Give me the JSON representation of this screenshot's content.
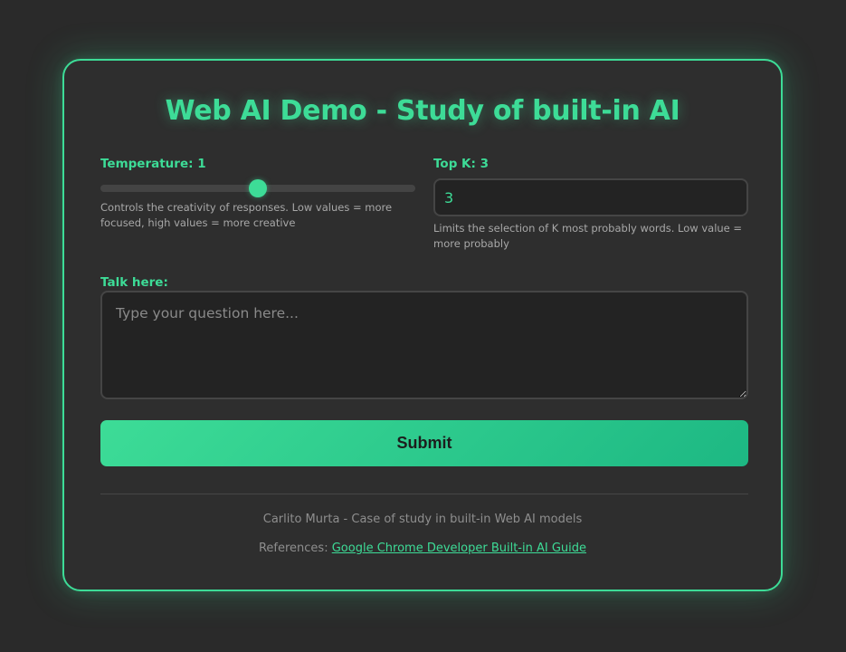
{
  "header": {
    "title": "Web AI Demo - Study of built-in AI"
  },
  "temperature": {
    "label": "Temperature: 1",
    "value": 1,
    "min": 0,
    "max": 2,
    "help": "Controls the creativity of responses. Low values = more focused, high values = more creative"
  },
  "top_k": {
    "label": "Top K: 3",
    "value": "3",
    "help": "Limits the selection of K most probably words. Low value = more probably"
  },
  "talk": {
    "label": "Talk here:",
    "placeholder": "Type your question here..."
  },
  "submit": {
    "label": "Submit"
  },
  "footer": {
    "credit": "Carlito Murta - Case of study in built-in Web AI models",
    "references_prefix": "References:",
    "references_link": "Google Chrome Developer Built-in AI Guide"
  },
  "colors": {
    "accent": "#3ddc97",
    "accent_dark": "#1db883",
    "background": "#2a2a2a",
    "card": "#2e2e2e"
  }
}
